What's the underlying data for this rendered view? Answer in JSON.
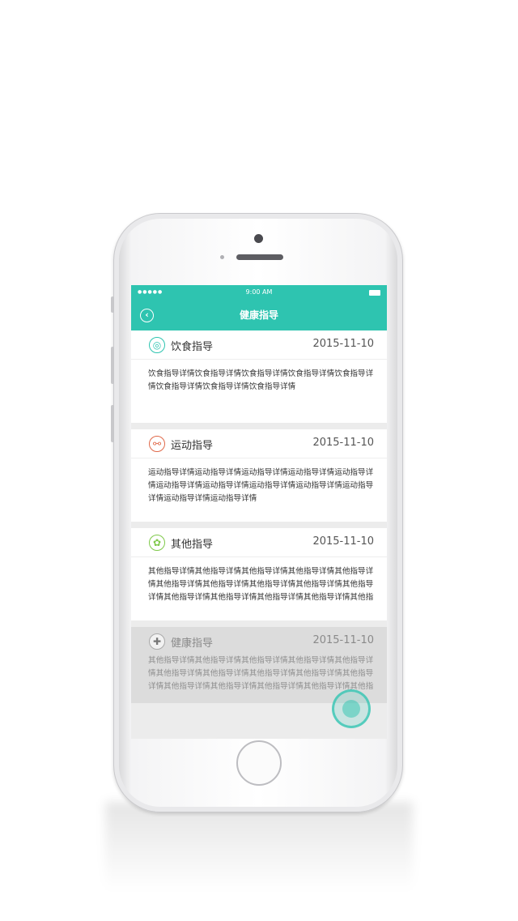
{
  "status_bar": {
    "signal": "●●●●●",
    "time": "9:00 AM"
  },
  "nav": {
    "title": "健康指导",
    "back_icon": "back-arrow-circle-icon"
  },
  "colors": {
    "accent": "#2ec4b0",
    "background": "#ececec"
  },
  "cards": [
    {
      "icon": "diet-icon",
      "icon_glyph": "◎",
      "title": "饮食指导",
      "date": "2015-11-10",
      "body": "饮食指导详情饮食指导详情饮食指导详情饮食指导详情饮食指导详情饮食指导详情饮食指导详情饮食指导详情"
    },
    {
      "icon": "exercise-icon",
      "icon_glyph": "⚯",
      "title": "运动指导",
      "date": "2015-11-10",
      "body": "运动指导详情运动指导详情运动指导详情运动指导详情运动指导详情运动指导详情运动指导详情运动指导详情运动指导详情运动指导详情运动指导详情运动指导详情"
    },
    {
      "icon": "other-icon",
      "icon_glyph": "✿",
      "title": "其他指导",
      "date": "2015-11-10",
      "body": "其他指导详情其他指导详情其他指导详情其他指导详情其他指导详情其他指导详情其他指导详情其他指导详情其他指导详情其他指导详情其他指导详情其他指导详情其他指导详情其他指导详情其他指"
    },
    {
      "icon": "health-cross-icon",
      "icon_glyph": "✚",
      "title": "健康指导",
      "date": "2015-11-10",
      "body": "其他指导详情其他指导详情其他指导详情其他指导详情其他指导详情其他指导详情其他指导详情其他指导详情其他指导详情其他指导详情其他指导详情其他指导详情其他指导详情其他指导详情其他指"
    }
  ]
}
